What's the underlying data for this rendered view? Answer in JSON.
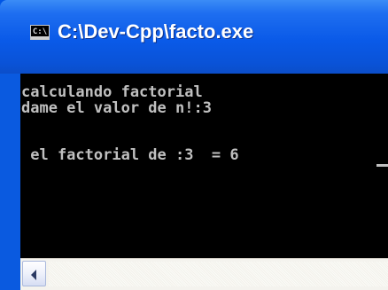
{
  "window": {
    "title": "C:\\Dev-Cpp\\facto.exe",
    "icon_name": "console-window-icon",
    "icon_glyph": "C:\\"
  },
  "console": {
    "lines": [
      "calculando factorial",
      "dame el valor de n!:3",
      "",
      " el factorial de :3  = 6 "
    ],
    "text_color": "#c0c0c0",
    "background": "#000000"
  },
  "scrollbar": {
    "orientation": "horizontal",
    "left_arrow_icon": "arrow-left-icon"
  },
  "colors": {
    "titlebar": "#0a5ae8",
    "title_text": "#ffffff"
  }
}
